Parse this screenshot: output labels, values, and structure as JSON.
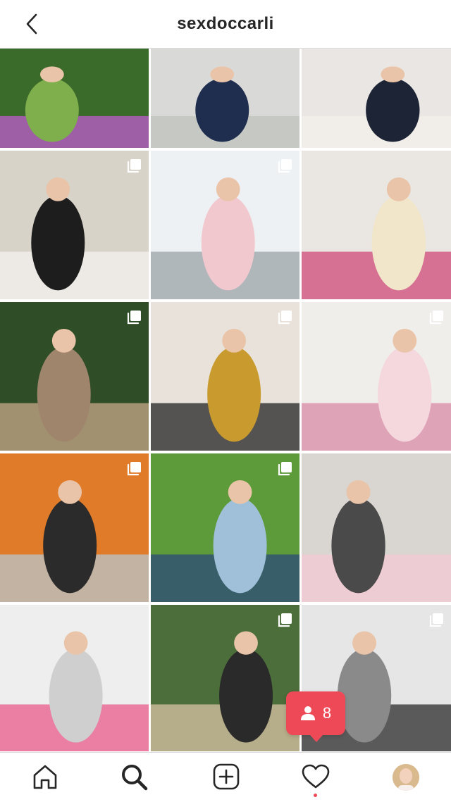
{
  "header": {
    "title": "sexdoccarli",
    "back_icon": "chevron-left-icon"
  },
  "grid": {
    "posts": [
      {
        "name": "post-swing",
        "multiple": false,
        "colors": [
          "#3b6b2a",
          "#7fae4c",
          "#c25bd0"
        ]
      },
      {
        "name": "post-shadow",
        "multiple": false,
        "colors": [
          "#d9dad7",
          "#1f2d4f",
          "#bfc2bc"
        ]
      },
      {
        "name": "post-mom-lifting",
        "multiple": false,
        "colors": [
          "#e9e6e3",
          "#1c2435",
          "#f3efe9"
        ]
      },
      {
        "name": "post-kitchen",
        "multiple": true,
        "colors": [
          "#d8d3c9",
          "#1d1d1d",
          "#f4f2ee"
        ]
      },
      {
        "name": "post-snow",
        "multiple": true,
        "colors": [
          "#eef1f4",
          "#f2c8cf",
          "#9aa3a8"
        ]
      },
      {
        "name": "post-office",
        "multiple": false,
        "colors": [
          "#eae7e2",
          "#f1e6c9",
          "#d04a7a"
        ]
      },
      {
        "name": "post-christmas-tree",
        "multiple": true,
        "colors": [
          "#2f4d27",
          "#a0856d",
          "#c9a88a"
        ]
      },
      {
        "name": "post-pregnancy-balloons",
        "multiple": true,
        "colors": [
          "#e9e2da",
          "#c99a2e",
          "#232323"
        ]
      },
      {
        "name": "post-pink-bow",
        "multiple": true,
        "colors": [
          "#f0eeeb",
          "#f5d7de",
          "#d98aa6"
        ]
      },
      {
        "name": "post-pumpkins",
        "multiple": true,
        "colors": [
          "#e07b2a",
          "#2b2b2b",
          "#b8c6cc"
        ]
      },
      {
        "name": "post-field",
        "multiple": true,
        "colors": [
          "#5d9a3a",
          "#9fc0d8",
          "#2c4a7a"
        ]
      },
      {
        "name": "post-mask",
        "multiple": false,
        "colors": [
          "#d9d6d1",
          "#4a4a4a",
          "#f3c9d3"
        ]
      },
      {
        "name": "post-laptop",
        "multiple": false,
        "colors": [
          "#eeeeee",
          "#cfcfcf",
          "#e85a8a"
        ]
      },
      {
        "name": "post-hug",
        "multiple": true,
        "colors": [
          "#4b6e3a",
          "#2a2a2a",
          "#d9c3a5"
        ]
      },
      {
        "name": "post-bw-family",
        "multiple": true,
        "colors": [
          "#e6e6e6",
          "#8a8a8a",
          "#2b2b2b"
        ]
      }
    ]
  },
  "notification_badge": {
    "count": "8",
    "icon": "person-icon"
  },
  "tabbar": {
    "icons": [
      "home-icon",
      "search-icon",
      "add-post-icon",
      "heart-icon",
      "profile-avatar"
    ],
    "accent": "#ed4956"
  }
}
